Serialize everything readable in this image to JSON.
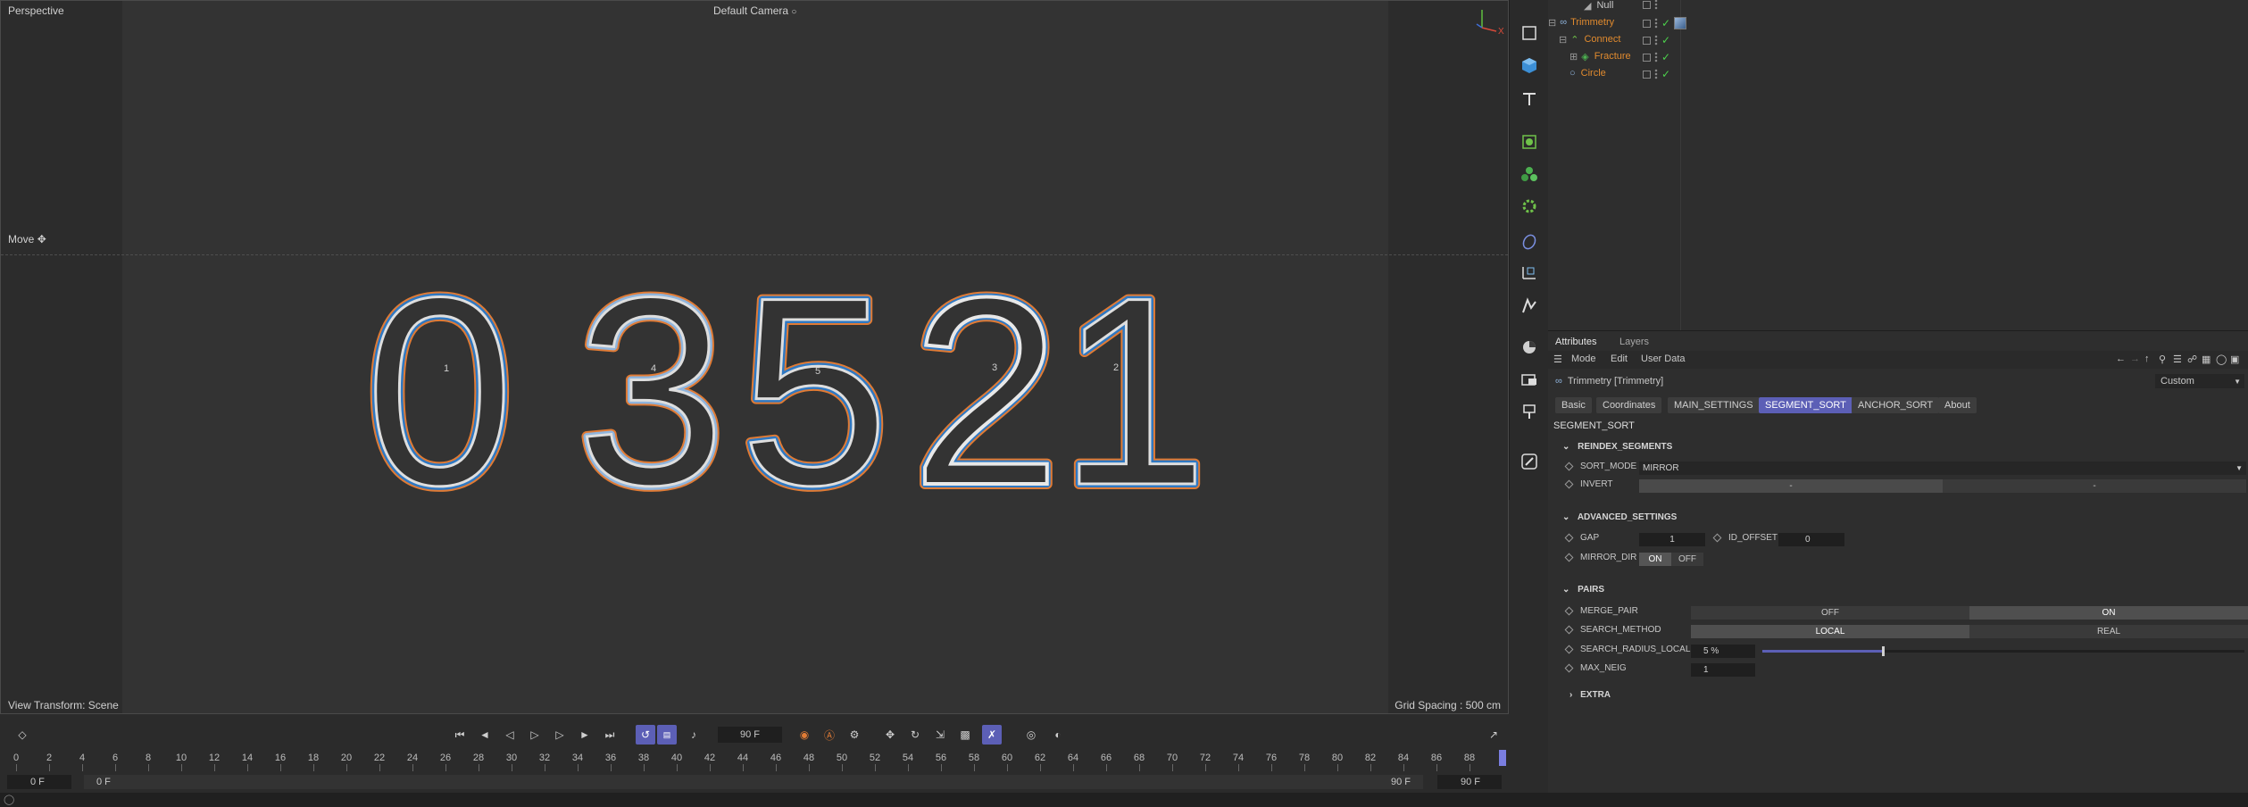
{
  "viewport": {
    "view_name": "Perspective",
    "camera": "Default Camera",
    "camera_icon": "camera-icon",
    "tool": "Move",
    "view_transform": "View Transform: Scene",
    "grid_spacing": "Grid Spacing : 500 cm",
    "axis_x": "X",
    "digits": [
      "0",
      "3",
      "5",
      "2",
      "1"
    ],
    "segment_ids": [
      "1",
      "4",
      "5",
      "3",
      "2"
    ],
    "colors": {
      "outline_orange": "#e07b35",
      "fill_blue": "#2f78c2",
      "fill_white": "#e8e8e8"
    }
  },
  "object_manager": {
    "objects": [
      {
        "name": "Null",
        "icon": "null-icon"
      },
      {
        "name": "Trimmetry",
        "icon": "trimmetry-icon"
      },
      {
        "name": "Connect",
        "icon": "connect-icon"
      },
      {
        "name": "Fracture",
        "icon": "fracture-icon"
      },
      {
        "name": "Circle",
        "icon": "circle-icon"
      }
    ]
  },
  "attributes": {
    "tabs": [
      "Attributes",
      "Layers"
    ],
    "menu": [
      "Mode",
      "Edit",
      "User Data"
    ],
    "object_title": "Trimmetry [Trimmetry]",
    "preset": "Custom",
    "page_tabs": [
      "Basic",
      "Coordinates",
      "MAIN_SETTINGS",
      "SEGMENT_SORT",
      "ANCHOR_SORT",
      "About"
    ],
    "active_tab": "SEGMENT_SORT",
    "page_title": "SEGMENT_SORT",
    "sections": {
      "reindex": "REINDEX_SEGMENTS",
      "advanced": "ADVANCED_SETTINGS",
      "pairs": "PAIRS",
      "extra": "EXTRA"
    },
    "params": {
      "sort_mode_label": "SORT_MODE",
      "sort_mode_value": "MIRROR",
      "invert_label": "INVERT",
      "invert_off": "-",
      "invert_on": "-",
      "gap_label": "GAP",
      "gap_value": "1",
      "id_offset_label": "ID_OFFSET",
      "id_offset_value": "0",
      "mirror_dir_label": "MIRROR_DIR",
      "mirror_on": "ON",
      "mirror_off": "OFF",
      "merge_pair_label": "MERGE_PAIR",
      "merge_off": "OFF",
      "merge_on": "ON",
      "search_method_label": "SEARCH_METHOD",
      "method_local": "LOCAL",
      "method_real": "REAL",
      "search_radius_label": "SEARCH_RADIUS_LOCAL",
      "search_radius_value": "5 %",
      "search_radius_fraction": 0.25,
      "max_neig_label": "MAX_NEIG",
      "max_neig_value": "1"
    }
  },
  "timeline": {
    "current_frame": "90 F",
    "ruler_ticks": [
      "0",
      "2",
      "4",
      "6",
      "8",
      "10",
      "12",
      "14",
      "16",
      "18",
      "20",
      "22",
      "24",
      "26",
      "28",
      "30",
      "32",
      "34",
      "36",
      "38",
      "40",
      "42",
      "44",
      "46",
      "48",
      "50",
      "52",
      "54",
      "56",
      "58",
      "60",
      "62",
      "64",
      "66",
      "68",
      "70",
      "72",
      "74",
      "76",
      "78",
      "80",
      "82",
      "84",
      "86",
      "88"
    ],
    "range_start": "0 F",
    "range_start_inner": "0 F",
    "range_end_inner": "90 F",
    "range_end": "90 F"
  }
}
